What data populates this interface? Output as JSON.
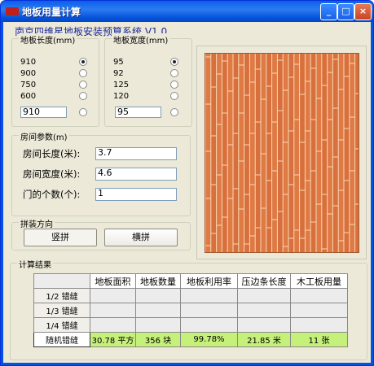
{
  "window": {
    "title": "地板用量计算",
    "buttons": {
      "minimize": "_",
      "maximize": "□",
      "close": "×"
    }
  },
  "subtitle": "南京四维星地板安装预算系统 V1.0",
  "length_group": {
    "legend": "地板长度(mm)",
    "options": [
      "910",
      "900",
      "750",
      "600"
    ],
    "selected_index": 0,
    "custom_value": "910"
  },
  "width_group": {
    "legend": "地板宽度(mm)",
    "options": [
      "95",
      "92",
      "125",
      "120"
    ],
    "selected_index": 0,
    "custom_value": "95"
  },
  "room_group": {
    "legend": "房间参数(m)",
    "fields": [
      {
        "label": "房间长度(米):",
        "value": "3.7"
      },
      {
        "label": "房间宽度(米):",
        "value": "4.6"
      },
      {
        "label": "门的个数(个):",
        "value": "1"
      }
    ]
  },
  "direction_group": {
    "legend": "拼装方向",
    "vertical_label": "竖拼",
    "horizontal_label": "横拼"
  },
  "results": {
    "legend": "计算结果",
    "headers": [
      "地板面积",
      "地板数量",
      "地板利用率",
      "压边条长度",
      "木工板用量"
    ],
    "rows": [
      {
        "label": "1/2 错缝",
        "values": [
          "",
          "",
          "",
          "",
          ""
        ]
      },
      {
        "label": "1/3 错缝",
        "values": [
          "",
          "",
          "",
          "",
          ""
        ]
      },
      {
        "label": "1/4 错缝",
        "values": [
          "",
          "",
          "",
          "",
          ""
        ]
      },
      {
        "label": "随机错缝",
        "values": [
          "30.78 平方",
          "356 块",
          "99.78%",
          "21.85 米",
          "11 张"
        ]
      }
    ]
  },
  "colors": {
    "plank": "#e07a45",
    "plank_alt": "#d86f3c",
    "seam": "#f4d9b6",
    "highlight": "#c5f07a"
  }
}
